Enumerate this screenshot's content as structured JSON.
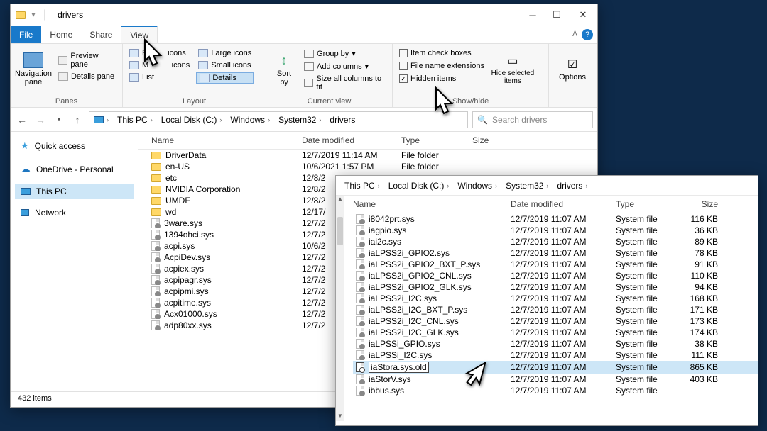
{
  "win1": {
    "title": "drivers",
    "menu": {
      "file": "File",
      "home": "Home",
      "share": "Share",
      "view": "View"
    },
    "ribbon": {
      "panes": {
        "nav": "Navigation\npane",
        "preview": "Preview pane",
        "details": "Details pane",
        "title": "Panes"
      },
      "layout": {
        "xlarge": "Ex",
        "xlarge2": "icons",
        "large": "Large icons",
        "medium": "M",
        "medium2": "icons",
        "small": "Small icons",
        "list": "List",
        "details": "Details",
        "title": "Layout"
      },
      "current": {
        "sort": "Sort\nby",
        "group": "Group by",
        "addcols": "Add columns",
        "sizecols": "Size all columns to fit",
        "title": "Current view"
      },
      "showhide": {
        "checkboxes": "Item check boxes",
        "ext": "File name extensions",
        "hidden": "Hidden items",
        "hidesel": "Hide selected\nitems",
        "title": "Show/hide"
      },
      "options": "Options"
    },
    "breadcrumb": [
      "This PC",
      "Local Disk (C:)",
      "Windows",
      "System32",
      "drivers"
    ],
    "search_placeholder": "Search drivers",
    "sidebar": {
      "quick": "Quick access",
      "onedrive": "OneDrive - Personal",
      "thispc": "This PC",
      "network": "Network"
    },
    "cols": {
      "name": "Name",
      "date": "Date modified",
      "type": "Type",
      "size": "Size"
    },
    "rows": [
      {
        "name": "DriverData",
        "date": "12/7/2019 11:14 AM",
        "type": "File folder",
        "size": "",
        "folder": true
      },
      {
        "name": "en-US",
        "date": "10/6/2021 1:57 PM",
        "type": "File folder",
        "size": "",
        "folder": true
      },
      {
        "name": "etc",
        "date": "12/8/2",
        "type": "",
        "size": "",
        "folder": true
      },
      {
        "name": "NVIDIA Corporation",
        "date": "12/8/2",
        "type": "",
        "size": "",
        "folder": true
      },
      {
        "name": "UMDF",
        "date": "12/8/2",
        "type": "",
        "size": "",
        "folder": true
      },
      {
        "name": "wd",
        "date": "12/17/",
        "type": "",
        "size": "",
        "folder": true
      },
      {
        "name": "3ware.sys",
        "date": "12/7/2",
        "type": "",
        "size": "",
        "folder": false
      },
      {
        "name": "1394ohci.sys",
        "date": "12/7/2",
        "type": "",
        "size": "",
        "folder": false
      },
      {
        "name": "acpi.sys",
        "date": "10/6/2",
        "type": "",
        "size": "",
        "folder": false
      },
      {
        "name": "AcpiDev.sys",
        "date": "12/7/2",
        "type": "",
        "size": "",
        "folder": false
      },
      {
        "name": "acpiex.sys",
        "date": "12/7/2",
        "type": "",
        "size": "",
        "folder": false
      },
      {
        "name": "acpipagr.sys",
        "date": "12/7/2",
        "type": "",
        "size": "",
        "folder": false
      },
      {
        "name": "acpipmi.sys",
        "date": "12/7/2",
        "type": "",
        "size": "",
        "folder": false
      },
      {
        "name": "acpitime.sys",
        "date": "12/7/2",
        "type": "",
        "size": "",
        "folder": false
      },
      {
        "name": "Acx01000.sys",
        "date": "12/7/2",
        "type": "",
        "size": "",
        "folder": false
      },
      {
        "name": "adp80xx.sys",
        "date": "12/7/2",
        "type": "",
        "size": "",
        "folder": false
      }
    ],
    "status": "432 items"
  },
  "win2": {
    "breadcrumb": [
      "This PC",
      "Local Disk (C:)",
      "Windows",
      "System32",
      "drivers"
    ],
    "cols": {
      "name": "Name",
      "date": "Date modified",
      "type": "Type",
      "size": "Size"
    },
    "rows": [
      {
        "name": "i8042prt.sys",
        "date": "12/7/2019 11:07 AM",
        "type": "System file",
        "size": "116 KB"
      },
      {
        "name": "iagpio.sys",
        "date": "12/7/2019 11:07 AM",
        "type": "System file",
        "size": "36 KB"
      },
      {
        "name": "iai2c.sys",
        "date": "12/7/2019 11:07 AM",
        "type": "System file",
        "size": "89 KB"
      },
      {
        "name": "iaLPSS2i_GPIO2.sys",
        "date": "12/7/2019 11:07 AM",
        "type": "System file",
        "size": "78 KB"
      },
      {
        "name": "iaLPSS2i_GPIO2_BXT_P.sys",
        "date": "12/7/2019 11:07 AM",
        "type": "System file",
        "size": "91 KB"
      },
      {
        "name": "iaLPSS2i_GPIO2_CNL.sys",
        "date": "12/7/2019 11:07 AM",
        "type": "System file",
        "size": "110 KB"
      },
      {
        "name": "iaLPSS2i_GPIO2_GLK.sys",
        "date": "12/7/2019 11:07 AM",
        "type": "System file",
        "size": "94 KB"
      },
      {
        "name": "iaLPSS2i_I2C.sys",
        "date": "12/7/2019 11:07 AM",
        "type": "System file",
        "size": "168 KB"
      },
      {
        "name": "iaLPSS2i_I2C_BXT_P.sys",
        "date": "12/7/2019 11:07 AM",
        "type": "System file",
        "size": "171 KB"
      },
      {
        "name": "iaLPSS2i_I2C_CNL.sys",
        "date": "12/7/2019 11:07 AM",
        "type": "System file",
        "size": "173 KB"
      },
      {
        "name": "iaLPSS2i_I2C_GLK.sys",
        "date": "12/7/2019 11:07 AM",
        "type": "System file",
        "size": "174 KB"
      },
      {
        "name": "iaLPSSi_GPIO.sys",
        "date": "12/7/2019 11:07 AM",
        "type": "System file",
        "size": "38 KB"
      },
      {
        "name": "iaLPSSi_I2C.sys",
        "date": "12/7/2019 11:07 AM",
        "type": "System file",
        "size": "111 KB"
      },
      {
        "name": "iaStora.sys.old",
        "date": "12/7/2019 11:07 AM",
        "type": "System file",
        "size": "865 KB",
        "sel": true
      },
      {
        "name": "iaStorV.sys",
        "date": "12/7/2019 11:07 AM",
        "type": "System file",
        "size": "403 KB"
      },
      {
        "name": "ibbus.sys",
        "date": "12/7/2019 11:07 AM",
        "type": "System file",
        "size": ""
      }
    ]
  }
}
